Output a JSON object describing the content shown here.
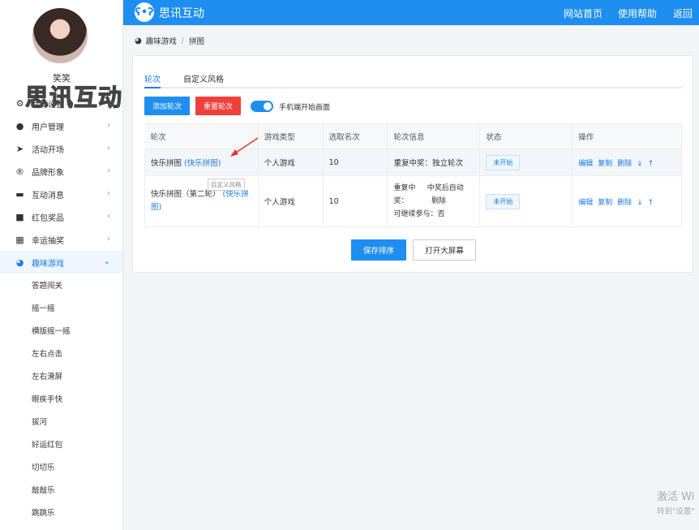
{
  "user": {
    "name": "笑笑"
  },
  "watermark": "思讯互动",
  "brand": {
    "name": "思讯互动"
  },
  "top_links": [
    "网站首页",
    "使用帮助",
    "返回"
  ],
  "menu": [
    {
      "label": "活动设置",
      "icon": "gear-icon"
    },
    {
      "label": "用户管理",
      "icon": "user-icon"
    },
    {
      "label": "活动开场",
      "icon": "paper-plane-icon"
    },
    {
      "label": "品牌形象",
      "icon": "registered-icon"
    },
    {
      "label": "互动消息",
      "icon": "message-icon"
    },
    {
      "label": "红包奖品",
      "icon": "gift-icon"
    },
    {
      "label": "幸运抽奖",
      "icon": "lottery-icon"
    },
    {
      "label": "趣味游戏",
      "icon": "game-icon",
      "active": true
    }
  ],
  "submenu": [
    "答题闯关",
    "摇一摇",
    "横版摇一摇",
    "左右点击",
    "左右滑屏",
    "眼疾手快",
    "拔河",
    "好运红包",
    "切切乐",
    "敲敲乐",
    "跳跳乐"
  ],
  "breadcrumb": [
    "趣味游戏",
    "拼图"
  ],
  "tabs": [
    "轮次",
    "自定义风格"
  ],
  "buttons": {
    "add": "添加轮次",
    "reset": "重置轮次",
    "toggle_label": "手机端开始画面",
    "save": "保存排序",
    "bigscreen": "打开大屏幕"
  },
  "table": {
    "headers": [
      "轮次",
      "游戏类型",
      "选取名次",
      "轮次信息",
      "状态",
      "操作"
    ],
    "rows": [
      {
        "name": "快乐拼图",
        "link": "(快乐拼图)",
        "type": "个人游戏",
        "rank": "10",
        "info": [
          "重复中奖：独立轮次"
        ],
        "status": "未开始"
      },
      {
        "name": "快乐拼图（第二轮）",
        "link": "(快乐拼图)",
        "type": "个人游戏",
        "rank": "10",
        "info": [
          "重复中     中奖后自动",
          "奖：          剔除",
          "可继续参与：否"
        ],
        "status": "未开始"
      }
    ],
    "ops": [
      "编辑",
      "复制",
      "删除",
      "↓",
      "↑"
    ]
  },
  "tooltip": "自定义风格",
  "windows_notice": {
    "line1": "激活 Wi",
    "line2": "转到\"设置\""
  },
  "colors": {
    "primary": "#1e8ef0",
    "danger": "#f0403c",
    "link": "#1e7ce3"
  }
}
